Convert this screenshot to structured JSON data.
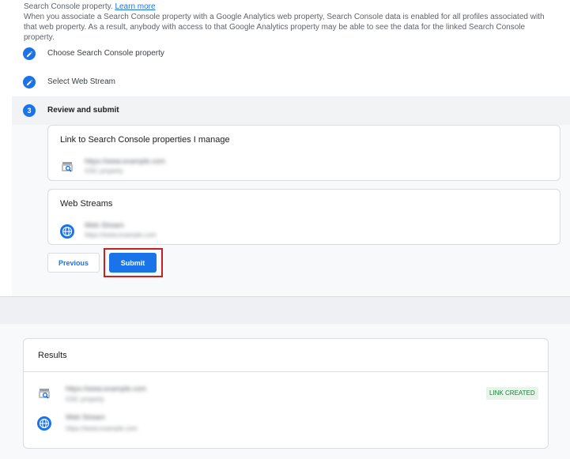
{
  "intro": {
    "line1": "Search Console property.",
    "learn_more": "Learn more",
    "line2": "When you associate a Search Console property with a Google Analytics web property, Search Console data is enabled for all profiles associated with that web property. As a result, anybody with access to that Google Analytics property may be able to see the data for the linked Search Console property."
  },
  "steps": [
    {
      "label": "Choose Search Console property",
      "state": "done"
    },
    {
      "label": "Select Web Stream",
      "state": "done"
    },
    {
      "number": "3",
      "label": "Review and submit",
      "state": "active"
    }
  ],
  "review": {
    "sc_card": {
      "title": "Link to Search Console properties I manage",
      "property_url": "https://www.example.com",
      "property_sub": "GSC property"
    },
    "ws_card": {
      "title": "Web Streams",
      "stream_name": "Web Stream",
      "stream_url": "https://www.example.com"
    }
  },
  "buttons": {
    "previous": "Previous",
    "submit": "Submit"
  },
  "results": {
    "title": "Results",
    "property_url": "https://www.example.com",
    "property_sub": "GSC property",
    "stream_name": "Web Stream",
    "stream_url": "https://www.example.com",
    "status": "LINK CREATED"
  },
  "colors": {
    "accent": "#1a73e8",
    "highlight": "#c5221f",
    "success_bg": "#e6f4ea",
    "success_text": "#188038"
  }
}
